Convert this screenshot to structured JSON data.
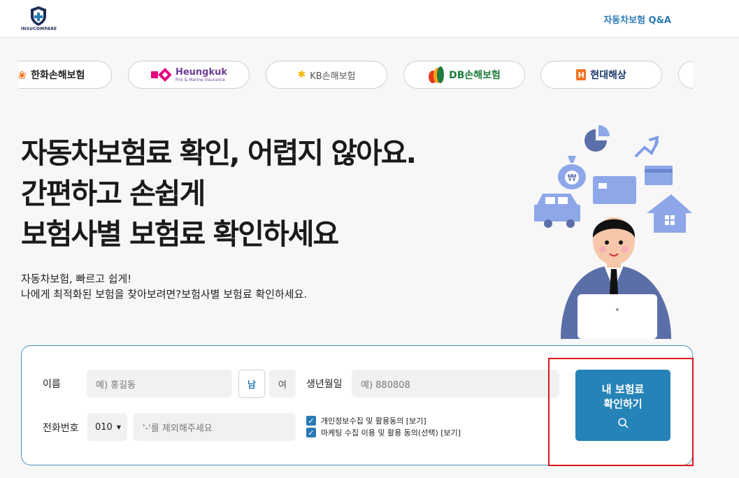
{
  "header": {
    "logo_text": "INSUCOMPARE",
    "nav_link": "자동차보험 Q&A"
  },
  "insurers": [
    {
      "name": "한화손해보험",
      "color": "#222222"
    },
    {
      "name": "Heungkuk",
      "sub": "Fire & Marine Insurance",
      "color": "#6b3e91"
    },
    {
      "name": "KB손해보험",
      "color": "#555555"
    },
    {
      "name": "DB손해보험",
      "color": "#1f7a3c"
    },
    {
      "name": "현대해상",
      "color": "#1a3a6b"
    }
  ],
  "hero": {
    "title_line1": "자동차보험료 확인, 어렵지 않아요.",
    "title_line2": "간편하고 손쉽게",
    "title_line3": "보험사별 보험료 확인하세요",
    "sub_line1": "자동차보험, 빠르고 쉽게!",
    "sub_line2": "나에게 최적화된 보험을 찾아보려면?보험사별 보험료 확인하세요."
  },
  "form": {
    "name_label": "이름",
    "name_placeholder": "예) 홍길동",
    "gender_male": "남",
    "gender_female": "여",
    "birth_label": "생년월일",
    "birth_placeholder": "예) 880808",
    "phone_label": "전화번호",
    "phone_prefix": "010",
    "phone_placeholder": "'-'를 제외해주세요",
    "consent_privacy": "개인정보수집 및 활용동의 [보기]",
    "consent_marketing": "마케팅 수집 이용 및 활용 동의(선택) [보기]",
    "submit_line1": "내 보험료",
    "submit_line2": "확인하기"
  },
  "colors": {
    "brand": "#2683b7",
    "link": "#2a7ab5",
    "highlight": "#e0161c"
  }
}
